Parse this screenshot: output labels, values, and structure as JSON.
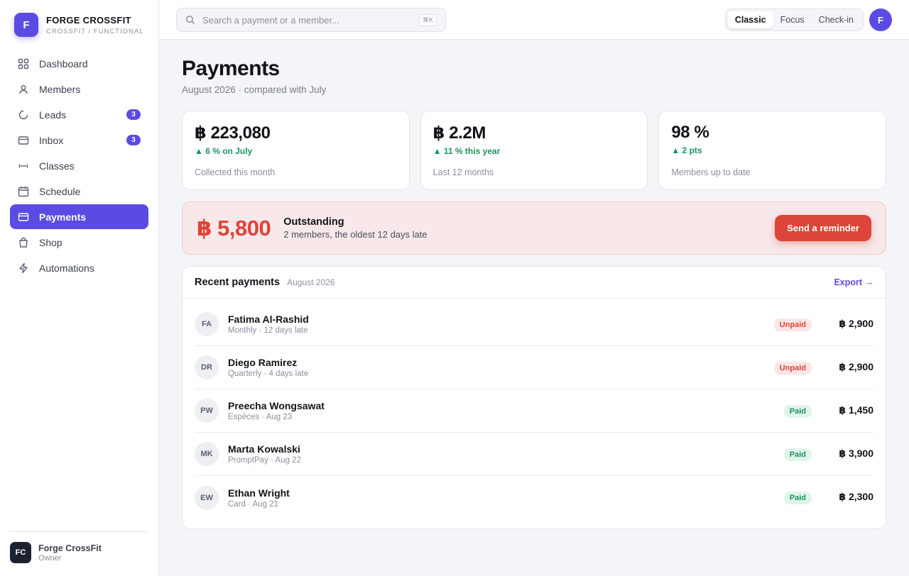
{
  "brand": {
    "logo_letter": "F",
    "name": "FORGE CROSSFIT",
    "subtitle": "CROSSFIT / FUNCTIONAL"
  },
  "sidebar": {
    "items": [
      {
        "label": "Dashboard",
        "icon": "grid-icon",
        "badge": ""
      },
      {
        "label": "Members",
        "icon": "user-icon",
        "badge": ""
      },
      {
        "label": "Leads",
        "icon": "loader-icon",
        "badge": "3"
      },
      {
        "label": "Inbox",
        "icon": "inbox-icon",
        "badge": "3"
      },
      {
        "label": "Classes",
        "icon": "dumbbell-icon",
        "badge": ""
      },
      {
        "label": "Schedule",
        "icon": "calendar-icon",
        "badge": ""
      },
      {
        "label": "Payments",
        "icon": "credit-card-icon",
        "badge": "",
        "active": true
      },
      {
        "label": "Shop",
        "icon": "shopping-bag-icon",
        "badge": ""
      },
      {
        "label": "Automations",
        "icon": "lightning-icon",
        "badge": ""
      }
    ],
    "footer": {
      "initials": "FC",
      "name": "Forge CrossFit",
      "role": "Owner"
    }
  },
  "topbar": {
    "search": {
      "placeholder": "Search a payment or a member...",
      "shortcut": "⌘K"
    },
    "modes": [
      {
        "label": "Classic",
        "active": true
      },
      {
        "label": "Focus",
        "active": false
      },
      {
        "label": "Check-in",
        "active": false
      }
    ],
    "user_initial": "F"
  },
  "page": {
    "title": "Payments",
    "subtitle": "August 2026 · compared with July"
  },
  "stats": [
    {
      "value": "฿ 223,080",
      "delta": "▲ 6 % on July",
      "label": "Collected this month"
    },
    {
      "value": "฿ 2.2M",
      "delta": "▲ 11 % this year",
      "label": "Last 12 months"
    },
    {
      "value": "98 %",
      "delta": "▲ 2 pts",
      "label": "Members up to date"
    }
  ],
  "outstanding": {
    "amount": "฿ 5,800",
    "title": "Outstanding",
    "description": "2 members, the oldest 12 days late",
    "button": "Send a reminder"
  },
  "recent": {
    "title": "Recent payments",
    "period": "August 2026",
    "export": "Export →",
    "rows": [
      {
        "initials": "FA",
        "name": "Fatima Al-Rashid",
        "meta": "Monthly · 12 days late",
        "status": "Unpaid",
        "status_type": "unpaid",
        "amount": "฿ 2,900"
      },
      {
        "initials": "DR",
        "name": "Diego Ramirez",
        "meta": "Quarterly · 4 days late",
        "status": "Unpaid",
        "status_type": "unpaid",
        "amount": "฿ 2,900"
      },
      {
        "initials": "PW",
        "name": "Preecha Wongsawat",
        "meta": "Espèces · Aug 23",
        "status": "Paid",
        "status_type": "paid",
        "amount": "฿ 1,450"
      },
      {
        "initials": "MK",
        "name": "Marta Kowalski",
        "meta": "PromptPay · Aug 22",
        "status": "Paid",
        "status_type": "paid",
        "amount": "฿ 3,900"
      },
      {
        "initials": "EW",
        "name": "Ethan Wright",
        "meta": "Card · Aug 21",
        "status": "Paid",
        "status_type": "paid",
        "amount": "฿ 2,300"
      }
    ]
  },
  "colors": {
    "accent": "#5b4be3",
    "danger": "#dc4537",
    "success": "#16955b"
  }
}
